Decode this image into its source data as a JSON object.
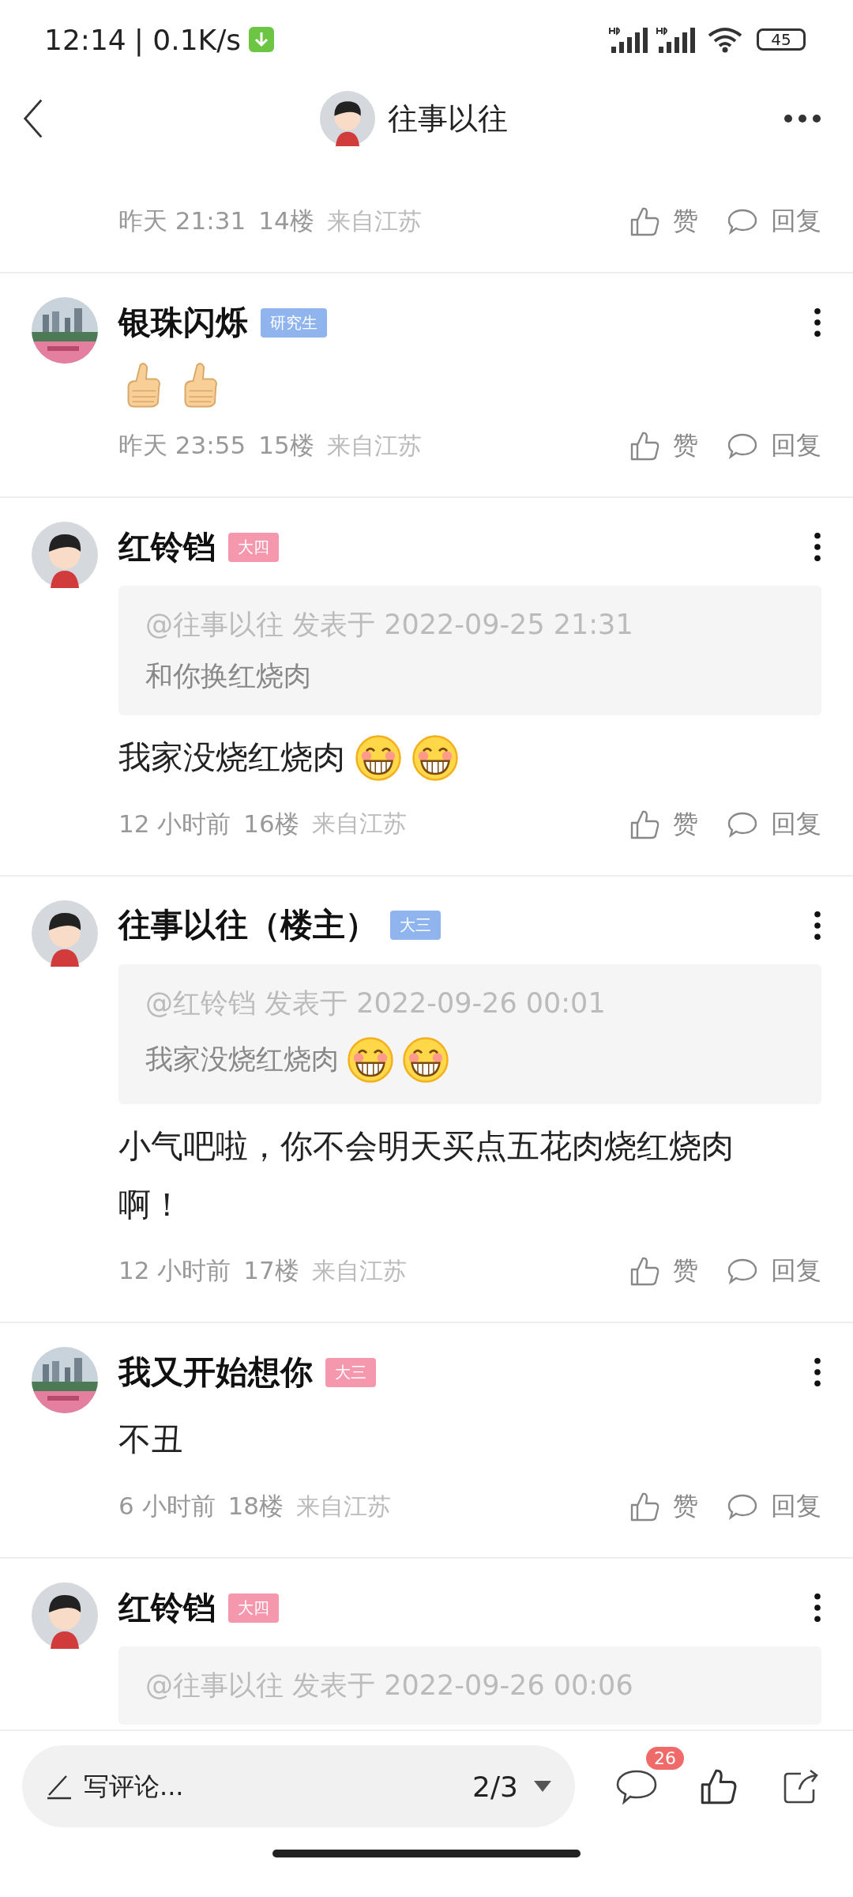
{
  "status_bar": {
    "time": "12:14",
    "speed": "| 0.1K/s",
    "battery": "45"
  },
  "header": {
    "title": "往事以往",
    "avatar": {
      "kind": "cartoon"
    }
  },
  "comments": [
    {
      "meta": {
        "time": "昨天 21:31",
        "floor": "14楼",
        "location": "来自江苏"
      },
      "like": "赞",
      "reply": "回复"
    },
    {
      "name": "银珠闪烁",
      "badge": {
        "label": "研究生",
        "color": "#8fb4ee"
      },
      "emojis": [
        {
          "kind": "thumbs"
        },
        {
          "kind": "thumbs"
        }
      ],
      "meta": {
        "time": "昨天 23:55",
        "floor": "15楼",
        "location": "来自江苏"
      },
      "like": "赞",
      "reply": "回复"
    },
    {
      "avatar": {
        "kind": "cartoon"
      },
      "name": "红铃铛",
      "badge": {
        "label": "大四",
        "color": "#f598ae"
      },
      "quote": {
        "source": "@往事以往 发表于 2022-09-25 21:31",
        "text": "和你换红烧肉"
      },
      "text": "我家没烧红烧肉",
      "emojis": [
        {
          "kind": "grin"
        },
        {
          "kind": "grin"
        }
      ],
      "meta": {
        "time": "12 小时前",
        "floor": "16楼",
        "location": "来自江苏"
      },
      "like": "赞",
      "reply": "回复"
    },
    {
      "avatar": {
        "kind": "cartoon"
      },
      "name": "往事以往（楼主）",
      "badge": {
        "label": "大三",
        "color": "#8fb4ee"
      },
      "quote": {
        "source": "@红铃铛 发表于 2022-09-26 00:01",
        "text": "我家没烧红烧肉",
        "emojis": [
          {
            "kind": "grin"
          },
          {
            "kind": "grin"
          }
        ]
      },
      "text": "小气吧啦，你不会明天买点五花肉烧红烧肉啊！",
      "meta": {
        "time": "12 小时前",
        "floor": "17楼",
        "location": "来自江苏"
      },
      "like": "赞",
      "reply": "回复"
    },
    {
      "name": "我又开始想你",
      "badge": {
        "label": "大三",
        "color": "#f598ae"
      },
      "text": "不丑",
      "meta": {
        "time": "6 小时前",
        "floor": "18楼",
        "location": "来自江苏"
      },
      "like": "赞",
      "reply": "回复"
    },
    {
      "avatar": {
        "kind": "cartoon"
      },
      "name": "红铃铛",
      "badge": {
        "label": "大四",
        "color": "#f598ae"
      },
      "quote": {
        "source": "@往事以往 发表于 2022-09-26 00:06"
      }
    }
  ],
  "bottom_bar": {
    "placeholder": "写评论...",
    "page": "2/3",
    "comment_count": "26"
  }
}
